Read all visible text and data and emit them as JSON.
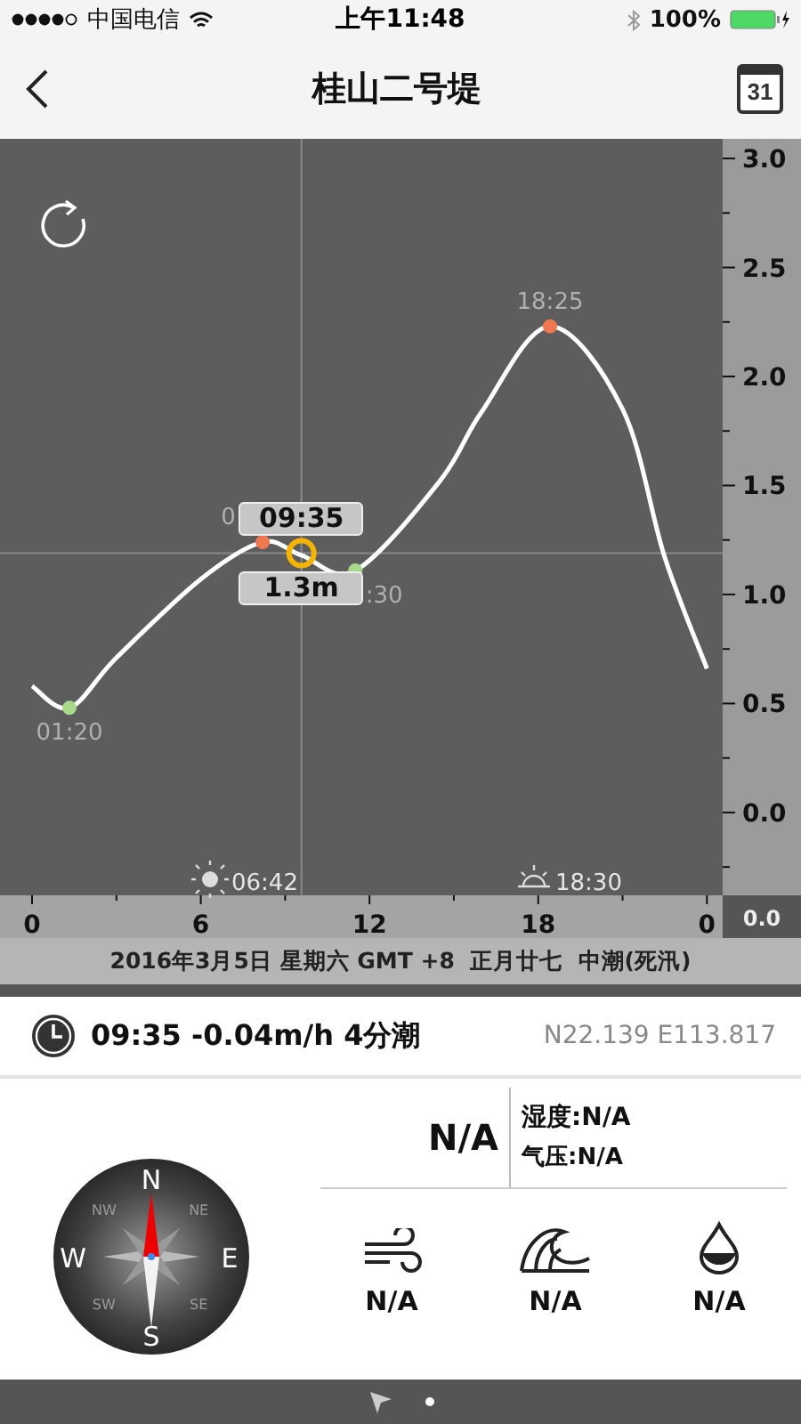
{
  "status_bar": {
    "carrier": "中国电信",
    "time": "上午11:48",
    "battery": "100%"
  },
  "nav": {
    "title": "桂山二号堤",
    "calendar_day": "31"
  },
  "chart": {
    "chart_data": {
      "type": "line",
      "x": [
        0,
        1.33,
        3,
        6,
        8.2,
        9.58,
        11.5,
        14.5,
        16,
        18.42,
        21,
        22.5,
        24
      ],
      "series": [
        {
          "color": "#ffffff",
          "values": [
            0.58,
            0.48,
            0.71,
            1.07,
            1.24,
            1.18,
            1.11,
            1.52,
            1.84,
            2.23,
            1.85,
            1.17,
            0.66
          ]
        }
      ],
      "xlim": [
        -1.14,
        24.56
      ],
      "ylim": [
        -0.38,
        3.09
      ],
      "xticks": [
        0,
        6,
        12,
        18
      ],
      "yticks": [
        {
          "value": 3,
          "label": "3.0"
        },
        {
          "value": 2.5,
          "label": "2.5"
        },
        {
          "value": 2,
          "label": "2.0"
        },
        {
          "value": 1.5,
          "label": "1.5"
        },
        {
          "value": 1,
          "label": "1.0"
        },
        {
          "value": 0.5,
          "label": "0.5"
        },
        {
          "value": 0,
          "label": "0.0"
        }
      ],
      "ref_lines": [
        {
          "axis": "x",
          "value": 9.58
        },
        {
          "axis": "y",
          "value": 1.19
        }
      ]
    },
    "x_end_label": "0",
    "extreme_labels": [
      "01:20",
      "0",
      ":30",
      "18:25"
    ],
    "sun_times": [
      {
        "kind": "sunrise",
        "time": "06:42"
      },
      {
        "kind": "sunset",
        "time": "18:30"
      }
    ],
    "cursor": {
      "time": "09:35",
      "height": "1.3m"
    },
    "corner_value": "0.0",
    "date_line": "2016年3月5日 星期六 GMT +8  正月廿七  中潮(死汛)"
  },
  "info": {
    "now": "09:35 -0.04m/h 4分潮",
    "coords": "N22.139 E113.817"
  },
  "weather": {
    "temperature": "N/A",
    "humidity": "湿度:N/A",
    "pressure": "气压:N/A",
    "items": [
      {
        "kind": "wind",
        "value": "N/A"
      },
      {
        "kind": "wave",
        "value": "N/A"
      },
      {
        "kind": "water",
        "value": "N/A"
      }
    ]
  },
  "compass": {
    "directions": [
      "N",
      "NE",
      "E",
      "SE",
      "S",
      "SW",
      "W",
      "NW"
    ]
  },
  "pager": {
    "pages": [
      {
        "kind": "location",
        "selected": false
      },
      {
        "kind": "dot",
        "selected": true
      }
    ]
  }
}
